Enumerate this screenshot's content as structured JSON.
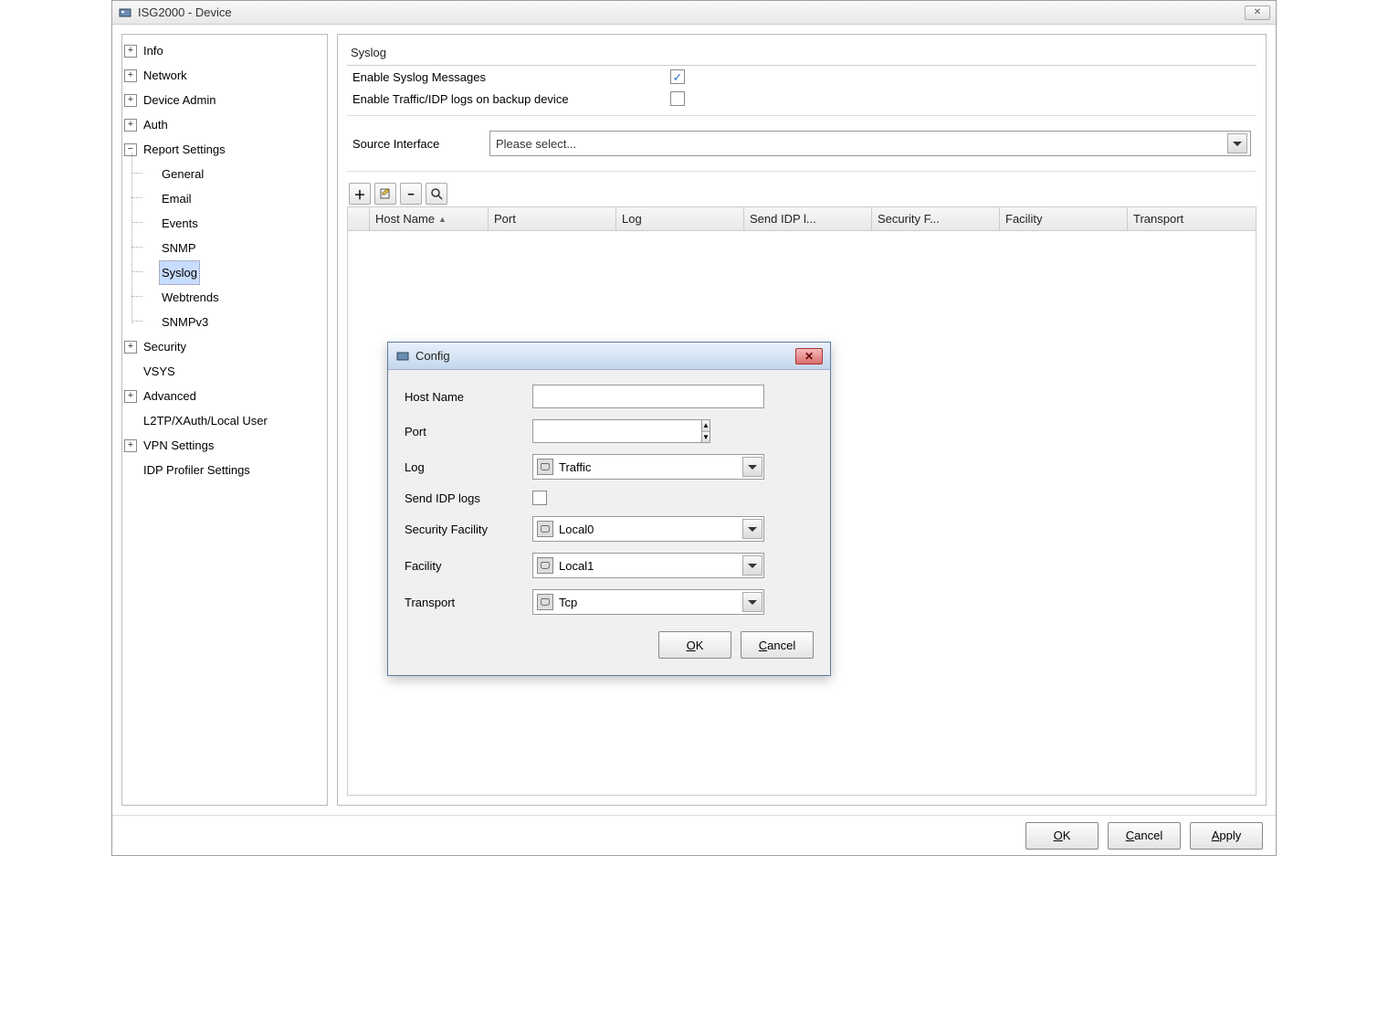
{
  "window": {
    "title": "ISG2000 - Device"
  },
  "tree": {
    "items": [
      {
        "label": "Info",
        "expander": "+"
      },
      {
        "label": "Network",
        "expander": "+"
      },
      {
        "label": "Device Admin",
        "expander": "+"
      },
      {
        "label": "Auth",
        "expander": "+"
      },
      {
        "label": "Report Settings",
        "expander": "−",
        "children": [
          {
            "label": "General"
          },
          {
            "label": "Email"
          },
          {
            "label": "Events"
          },
          {
            "label": "SNMP"
          },
          {
            "label": "Syslog",
            "selected": true
          },
          {
            "label": "Webtrends"
          },
          {
            "label": "SNMPv3"
          }
        ]
      },
      {
        "label": "Security",
        "expander": "+"
      },
      {
        "label": "VSYS"
      },
      {
        "label": "Advanced",
        "expander": "+"
      },
      {
        "label": "L2TP/XAuth/Local User"
      },
      {
        "label": "VPN Settings",
        "expander": "+"
      },
      {
        "label": "IDP Profiler Settings"
      }
    ]
  },
  "main": {
    "section_title": "Syslog",
    "opt1_label": "Enable Syslog Messages",
    "opt1_checked": true,
    "opt2_label": "Enable Traffic/IDP logs on backup device",
    "opt2_checked": false,
    "source_interface_label": "Source Interface",
    "source_interface_placeholder": "Please select...",
    "columns": [
      "",
      "Host Name",
      "Port",
      "Log",
      "Send IDP l...",
      "Security F...",
      "Facility",
      "Transport"
    ]
  },
  "dialog": {
    "title": "Config",
    "fields": {
      "host_name_label": "Host Name",
      "host_name_value": "",
      "port_label": "Port",
      "port_value": "",
      "log_label": "Log",
      "log_value": "Traffic",
      "send_idp_label": "Send IDP logs",
      "send_idp_checked": false,
      "sec_facility_label": "Security Facility",
      "sec_facility_value": "Local0",
      "facility_label": "Facility",
      "facility_value": "Local1",
      "transport_label": "Transport",
      "transport_value": "Tcp"
    },
    "ok": "OK",
    "cancel": "Cancel"
  },
  "footer": {
    "ok": "OK",
    "cancel": "Cancel",
    "apply": "Apply"
  }
}
